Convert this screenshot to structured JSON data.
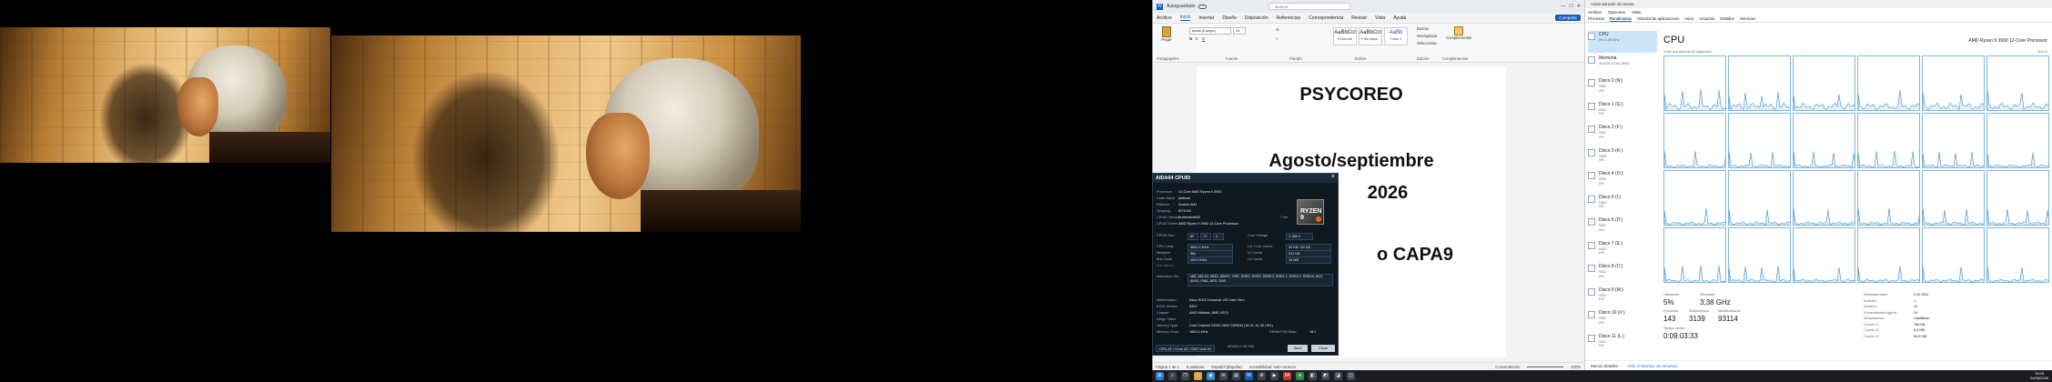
{
  "word": {
    "title_left": "Autoguardado",
    "search_placeholder": "Buscar",
    "menu": [
      "Archivo",
      "Inicio",
      "Insertar",
      "Diseño",
      "Disposición",
      "Referencias",
      "Correspondencia",
      "Revisar",
      "Vista",
      "Ayuda"
    ],
    "share_label": "Compartir",
    "paste_label": "Pegar",
    "font_name": "Aptos (Cuerpo)",
    "font_size": "24",
    "groups": [
      "Portapapeles",
      "Fuente",
      "Párrafo",
      "Estilos",
      "Edición",
      "Complementos"
    ],
    "styles": [
      {
        "sample": "AaBbCcI",
        "name": "¶ Normal"
      },
      {
        "sample": "AaBbCcI",
        "name": "¶ Sin espa..."
      },
      {
        "sample": "AaBb",
        "name": "Título 1"
      }
    ],
    "edit_items": [
      "Buscar",
      "Reemplazar",
      "Seleccionar"
    ],
    "addins_label": "Complementos",
    "doc_lines": [
      "PSYCOREO",
      "Agosto/septiembre",
      "2026",
      "o CAPA9"
    ],
    "status_page": "Página 1 de 1",
    "status_words": "6 palabras",
    "status_lang": "Español (España)",
    "status_access": "Accesibilidad: todo correcto",
    "status_focus": "Concentración",
    "zoom": "100%"
  },
  "aida": {
    "title": "AIDA64 CPUID",
    "rows": [
      {
        "k": "Processor",
        "v": "12-Core AMD Ryzen 9 3900"
      },
      {
        "k": "Code Name",
        "v": "Matisse"
      },
      {
        "k": "Platform",
        "v": "Socket AM4"
      },
      {
        "k": "Stepping",
        "v": "MTS-B0"
      },
      {
        "k": "CPUID Vendor",
        "v": "AuthenticAMD"
      },
      {
        "k": "CPUID Name",
        "v": "AMD Ryzen 9 3900 12-Core Processor"
      }
    ],
    "nm": "7 nm",
    "rev_label": "CPUID Rev.",
    "rev_vals": [
      "8F",
      "71",
      "0"
    ],
    "voltage_label": "Core Voltage",
    "voltage": "1.188 V",
    "clocks": [
      {
        "k": "CPU Clock",
        "v": "3800.1 MHz"
      },
      {
        "k": "Multiplier",
        "v": "38x"
      },
      {
        "k": "Bus Clock",
        "v": "100.0 MHz"
      },
      {
        "k": "Bus Speed",
        "v": ""
      }
    ],
    "caches": [
      {
        "k": "L1I / L1D Cache",
        "v": "32 KB / 32 KB"
      },
      {
        "k": "L2 Cache",
        "v": "512 KB"
      },
      {
        "k": "L3 Cache",
        "v": "16 MB"
      }
    ],
    "instr_label": "Instruction Set",
    "instr": "x86, x86-64, MMX, MMX+, SSE, SSE2, SSE3, SSSE3, SSE4.1, SSE4.2, SSE4A, AVX, AVX2, FMA, AES, SHA",
    "board": [
      {
        "k": "Motherboard",
        "v": "Asus ROG Crosshair VIII Dark Hero"
      },
      {
        "k": "BIOS Version",
        "v": "5302"
      },
      {
        "k": "Chipset",
        "v": "AMD Matisse, AMD X570"
      },
      {
        "k": "Integr. Video",
        "v": "-"
      },
      {
        "k": "Memory Type",
        "v": "Dual Channel DDR4-3600 SDRAM (16-21-16-36 CR1)"
      },
      {
        "k": "Memory Clock",
        "v": "1800.0 MHz"
      }
    ],
    "dram_ratio_label": "DRAM:FSB Ratio",
    "dram_ratio": "18:1",
    "cpu_select": "CPU #1 / Core #1 / SMT Unit #1",
    "version": "AIDA64 v7.35.7000",
    "save_label": "Save",
    "close_label": "Close",
    "logo_text": "RYZEN 9"
  },
  "tm": {
    "title": "Administrador de tareas",
    "menu": [
      "Archivo",
      "Opciones",
      "Vista"
    ],
    "tabs": [
      "Procesos",
      "Rendimiento",
      "Historial de aplicaciones",
      "Inicio",
      "Usuarios",
      "Detalles",
      "Servicios"
    ],
    "side": [
      {
        "name": "CPU",
        "sub": [
          "5%  3,38 GHz"
        ]
      },
      {
        "name": "Memoria",
        "sub": [
          "15,8/31,9 GB (49%)"
        ]
      },
      {
        "name": "Disco 0 (N:)",
        "sub": [
          "SSD",
          "0%"
        ]
      },
      {
        "name": "Disco 1 (G:)",
        "sub": [
          "SSD",
          "0%"
        ]
      },
      {
        "name": "Disco 2 (F:)",
        "sub": [
          "SSD",
          "0%"
        ]
      },
      {
        "name": "Disco 3 (K:)",
        "sub": [
          "HDD",
          "0%"
        ]
      },
      {
        "name": "Disco 4 (O:)",
        "sub": [
          "SSD",
          "0%"
        ]
      },
      {
        "name": "Disco 5 (I:)",
        "sub": [
          "HDD",
          "0%"
        ]
      },
      {
        "name": "Disco 6 (D:)",
        "sub": [
          "SSD",
          "0%"
        ]
      },
      {
        "name": "Disco 7 (E:)",
        "sub": [
          "HDD",
          "0%"
        ]
      },
      {
        "name": "Disco 8 (C:)",
        "sub": [
          "SSD",
          "0%"
        ]
      },
      {
        "name": "Disco 9 (M:)",
        "sub": [
          "SSD",
          "0%"
        ]
      },
      {
        "name": "Disco 10 (V:)",
        "sub": [
          "SSD",
          "0%"
        ]
      },
      {
        "name": "Disco 11 (L:)",
        "sub": [
          "SSD",
          "0%"
        ]
      }
    ],
    "cpu_title": "CPU",
    "cpu_model": "AMD Ryzen 9 3900 12-Core Processor",
    "graph_label": "% de uso durante 60 segundos",
    "graph_max": "100 %",
    "utilization_label": "Utilización",
    "utilization": "5%",
    "speed_label": "Velocidad",
    "speed": "3,38 GHz",
    "processes_label": "Procesos",
    "processes": "143",
    "threads_label": "Subprocesos",
    "threads": "3139",
    "handles_label": "Identificadores",
    "handles": "93114",
    "uptime_label": "Tiempo activo",
    "uptime": "0:09:03:33",
    "specs": [
      {
        "k": "Velocidad base:",
        "v": "3,10 GHz"
      },
      {
        "k": "Sockets:",
        "v": "1"
      },
      {
        "k": "Núcleos:",
        "v": "12"
      },
      {
        "k": "Procesadores lógicos:",
        "v": "24"
      },
      {
        "k": "Virtualización:",
        "v": "Habilitado"
      },
      {
        "k": "Caché L1:",
        "v": "768 KB"
      },
      {
        "k": "Caché L2:",
        "v": "6,0 MB"
      },
      {
        "k": "Caché L3:",
        "v": "64,0 MB"
      }
    ],
    "footer_less": "Menos detalles",
    "footer_monitor": "Abrir el Monitor de recursos"
  },
  "taskbar": {
    "time": "19:03",
    "date": "24/08/2026"
  }
}
